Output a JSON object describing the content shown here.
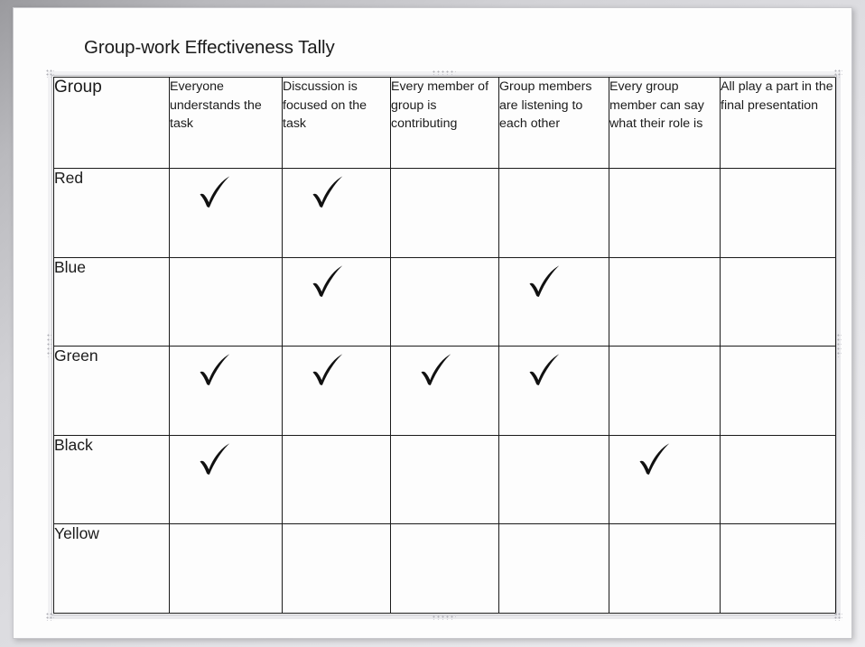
{
  "slide": {
    "title": "Group-work Effectiveness Tally"
  },
  "table": {
    "columns": [
      "Group",
      "Everyone understands the task",
      "Discussion is focused on the task",
      "Every member of group is contributing",
      "Group members are listening to each other",
      "Every group member can say what their role is",
      "All play a part in the final presentation"
    ],
    "rows": [
      {
        "group": "Red",
        "checks": [
          true,
          true,
          false,
          false,
          false,
          false
        ]
      },
      {
        "group": "Blue",
        "checks": [
          false,
          true,
          false,
          true,
          false,
          false
        ]
      },
      {
        "group": "Green",
        "checks": [
          true,
          true,
          true,
          true,
          false,
          false
        ]
      },
      {
        "group": "Black",
        "checks": [
          true,
          false,
          false,
          false,
          true,
          false
        ]
      },
      {
        "group": "Yellow",
        "checks": [
          false,
          false,
          false,
          false,
          false,
          false
        ]
      }
    ],
    "check_glyph": "check-mark"
  },
  "chart_data": {
    "type": "table",
    "title": "Group-work Effectiveness Tally",
    "categories": [
      "Everyone understands the task",
      "Discussion is focused on the task",
      "Every member of group is contributing",
      "Group members are listening to each other",
      "Every group member can say what their role is",
      "All play a part in the final presentation"
    ],
    "series": [
      {
        "name": "Red",
        "values": [
          1,
          1,
          0,
          0,
          0,
          0
        ]
      },
      {
        "name": "Blue",
        "values": [
          0,
          1,
          0,
          1,
          0,
          0
        ]
      },
      {
        "name": "Green",
        "values": [
          1,
          1,
          1,
          1,
          0,
          0
        ]
      },
      {
        "name": "Black",
        "values": [
          1,
          0,
          0,
          0,
          1,
          0
        ]
      },
      {
        "name": "Yellow",
        "values": [
          0,
          0,
          0,
          0,
          0,
          0
        ]
      }
    ],
    "row_totals": {
      "Red": 2,
      "Blue": 2,
      "Green": 4,
      "Black": 2,
      "Yellow": 0
    },
    "column_totals": [
      3,
      3,
      1,
      2,
      1,
      0
    ],
    "xlabel": "",
    "ylabel": "",
    "grid": true,
    "legend": "none"
  },
  "colors": {
    "page_background": "#fdfdfd",
    "canvas_background": "#d2d2d6",
    "text": "#1b1b1b",
    "table_border": "#1a1a1a",
    "selection_frame": "#e9e9ec"
  },
  "selection": {
    "handles": [
      "top-left",
      "top-center",
      "top-right",
      "middle-left",
      "middle-right",
      "bottom-left",
      "bottom-center",
      "bottom-right"
    ]
  }
}
